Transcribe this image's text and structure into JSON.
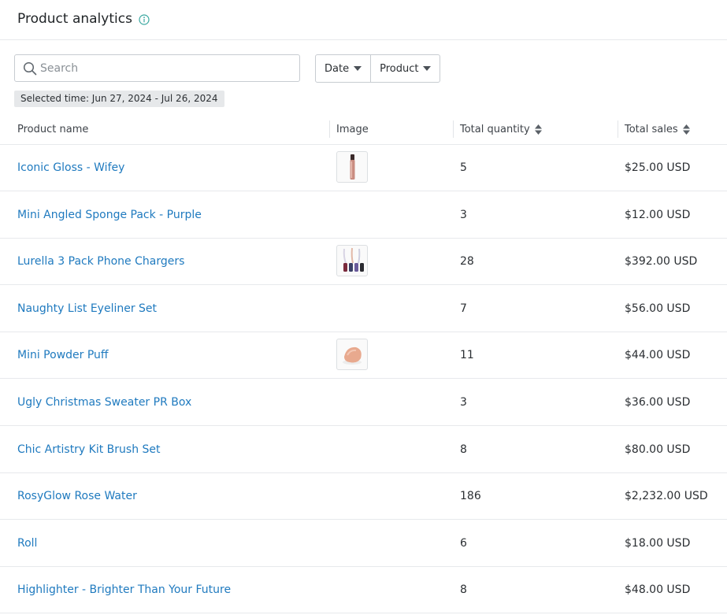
{
  "header": {
    "title": "Product analytics",
    "info_icon": "info-circle-icon"
  },
  "search": {
    "placeholder": "Search",
    "value": "",
    "icon": "search-icon"
  },
  "filters": [
    {
      "label": "Date",
      "icon": "caret-down-icon"
    },
    {
      "label": "Product",
      "icon": "caret-down-icon"
    }
  ],
  "selected_time": "Selected time: Jun 27, 2024 - Jul 26, 2024",
  "table": {
    "columns": [
      "Product name",
      "Image",
      "Total quantity",
      "Total sales"
    ],
    "rows": [
      {
        "name": "Iconic Gloss - Wifey",
        "image": "lip-gloss",
        "quantity": "5",
        "sales": "$25.00 USD"
      },
      {
        "name": "Mini Angled Sponge Pack - Purple",
        "image": "",
        "quantity": "3",
        "sales": "$12.00 USD"
      },
      {
        "name": "Lurella 3 Pack Phone Chargers",
        "image": "phone-chargers",
        "quantity": "28",
        "sales": "$392.00 USD"
      },
      {
        "name": "Naughty List Eyeliner Set",
        "image": "",
        "quantity": "7",
        "sales": "$56.00 USD"
      },
      {
        "name": "Mini Powder Puff",
        "image": "powder-puff",
        "quantity": "11",
        "sales": "$44.00 USD"
      },
      {
        "name": "Ugly Christmas Sweater PR Box",
        "image": "",
        "quantity": "3",
        "sales": "$36.00 USD"
      },
      {
        "name": "Chic Artistry Kit Brush Set",
        "image": "",
        "quantity": "8",
        "sales": "$80.00 USD"
      },
      {
        "name": "RosyGlow Rose Water",
        "image": "",
        "quantity": "186",
        "sales": "$2,232.00 USD"
      },
      {
        "name": "Roll",
        "image": "",
        "quantity": "6",
        "sales": "$18.00 USD"
      },
      {
        "name": "Highlighter - Brighter Than Your Future",
        "image": "",
        "quantity": "8",
        "sales": "$48.00 USD"
      }
    ]
  },
  "colors": {
    "link": "#1f7abf",
    "info_icon": "#3aa8a0",
    "border": "#e7e9ec"
  }
}
